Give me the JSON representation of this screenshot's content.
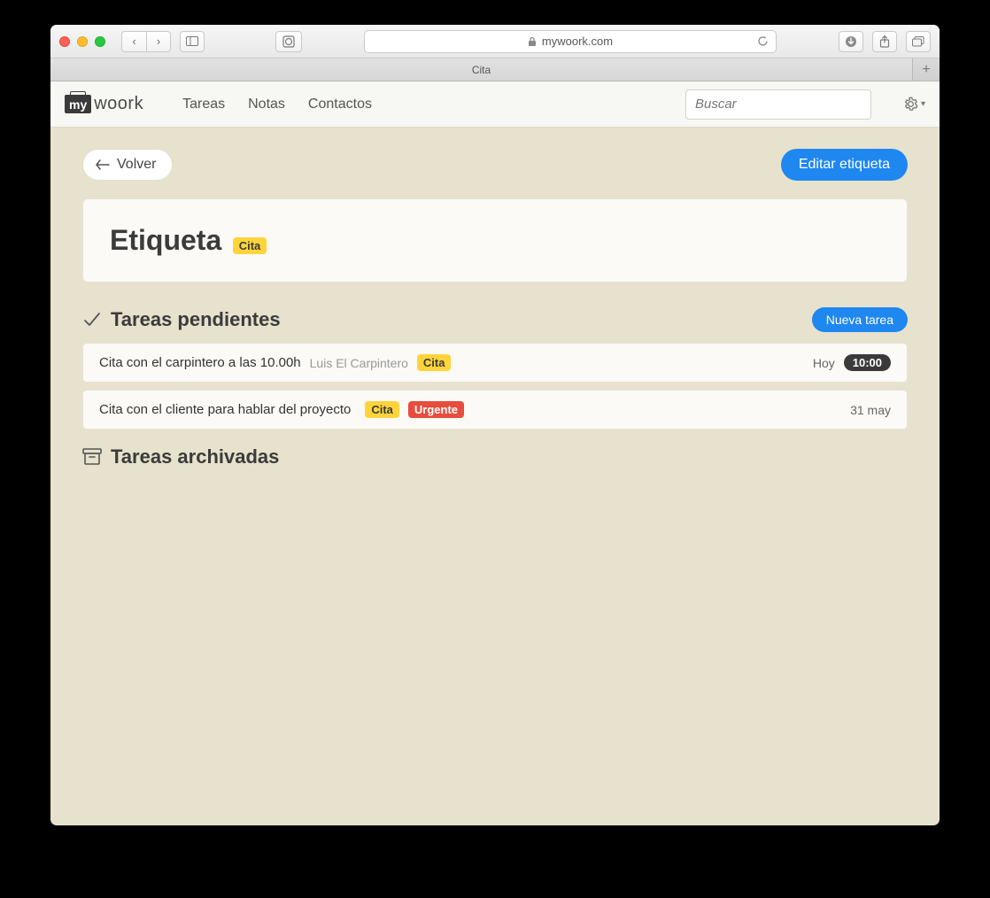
{
  "browser": {
    "url": "mywoork.com",
    "tab_title": "Cita"
  },
  "header": {
    "logo_prefix": "my",
    "logo_text": "woork",
    "nav": [
      "Tareas",
      "Notas",
      "Contactos"
    ],
    "search_placeholder": "Buscar"
  },
  "actions": {
    "back": "Volver",
    "edit": "Editar etiqueta",
    "new_task": "Nueva tarea"
  },
  "tag_card": {
    "title": "Etiqueta",
    "tag": "Cita"
  },
  "sections": {
    "pending": "Tareas pendientes",
    "archived": "Tareas archivadas"
  },
  "tasks": [
    {
      "title": "Cita con el carpintero a las 10.00h",
      "subtitle": "Luis El Carpintero",
      "tags": [
        {
          "label": "Cita",
          "color": "yellow"
        }
      ],
      "date": "Hoy",
      "time": "10:00"
    },
    {
      "title": "Cita con el cliente para hablar del proyecto",
      "subtitle": "",
      "tags": [
        {
          "label": "Cita",
          "color": "yellow"
        },
        {
          "label": "Urgente",
          "color": "red"
        }
      ],
      "date": "31 may",
      "time": ""
    }
  ]
}
